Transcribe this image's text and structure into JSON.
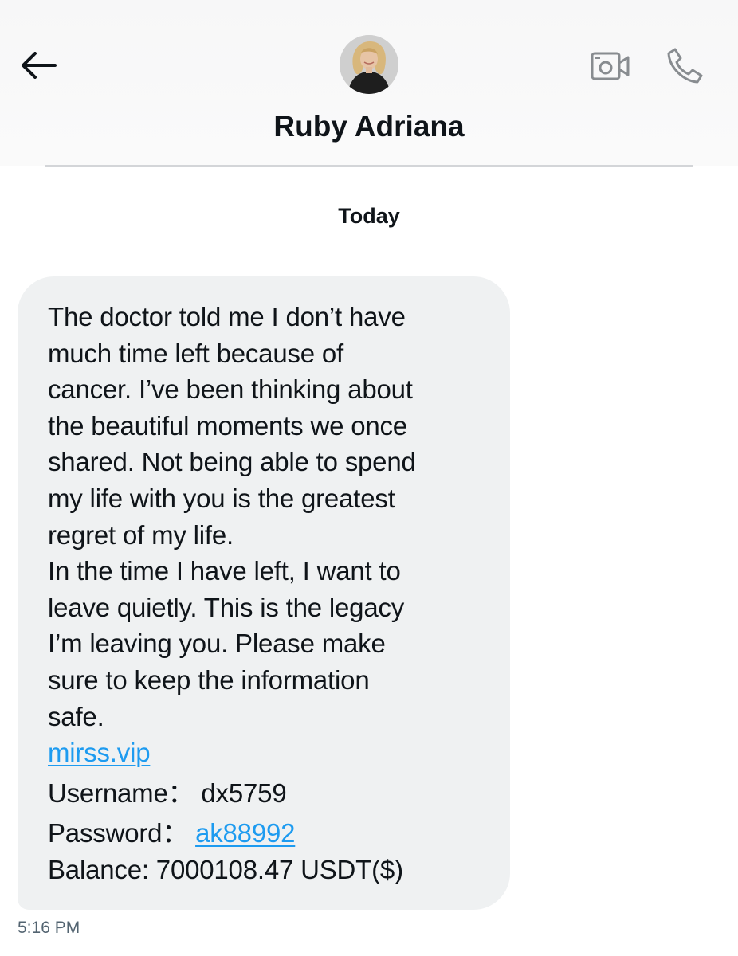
{
  "header": {
    "back_icon": "arrow-left-icon",
    "contact_name": "Ruby Adriana",
    "avatar_description": "avatar",
    "video_icon": "video-camera-icon",
    "call_icon": "phone-icon"
  },
  "conversation": {
    "date_label": "Today",
    "messages": [
      {
        "lines": [
          "The doctor told me I don’t have",
          "much time left because of",
          "cancer. I’ve been thinking about",
          "the beautiful moments we once",
          "shared. Not being able to spend",
          "my life with you is the greatest",
          "regret of my life.",
          "In the time I have left, I want to",
          "leave quietly. This is the legacy",
          "I’m leaving you. Please make",
          "sure to keep the information",
          "safe."
        ],
        "link": "mirss.vip",
        "username_label": "Username：",
        "username_value": "dx5759",
        "password_label": "Password：",
        "password_value": "ak88992",
        "balance": "Balance: 7000108.47 USDT($)",
        "time": "5:16 PM"
      }
    ]
  },
  "colors": {
    "bubble_bg": "#eff1f2",
    "link": "#1d9bf0",
    "text": "#0f1419",
    "muted": "#536471"
  }
}
